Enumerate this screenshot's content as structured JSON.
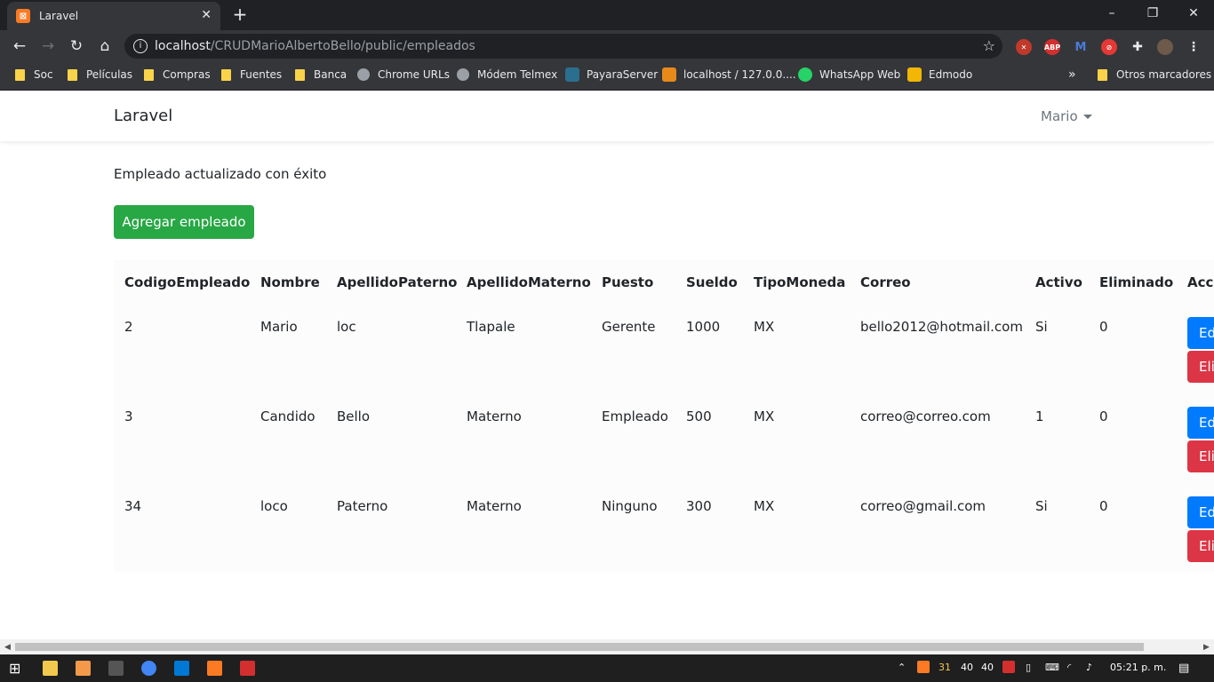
{
  "browser": {
    "tab_title": "Laravel",
    "tab_close": "✕",
    "new_tab": "+",
    "window_controls": {
      "minimize": "–",
      "restore": "❐",
      "close": "✕"
    },
    "url_host": "localhost",
    "url_path": "/CRUDMarioAlbertoBello/public/empleados",
    "extension_abp": "ABP",
    "bookmarks": [
      "Soc",
      "Películas",
      "Compras",
      "Fuentes",
      "Banca",
      "Chrome URLs",
      "Módem Telmex",
      "PayaraServer",
      "localhost / 127.0.0....",
      "WhatsApp Web",
      "Edmodo"
    ],
    "bookmarks_overflow": "»",
    "other_bookmarks": "Otros marcadores"
  },
  "app": {
    "brand": "Laravel",
    "user": "Mario",
    "flash_message": "Empleado actualizado con éxito",
    "add_button": "Agregar empleado"
  },
  "table": {
    "headers": [
      "CodigoEmpleado",
      "Nombre",
      "ApellidoPaterno",
      "ApellidoMaterno",
      "Puesto",
      "Sueldo",
      "TipoMoneda",
      "Correo",
      "Activo",
      "Eliminado",
      "Acci"
    ],
    "rows": [
      [
        "2",
        "Mario",
        "loc",
        "Tlapale",
        "Gerente",
        "1000",
        "MX",
        "bello2012@hotmail.com",
        "Si",
        "0"
      ],
      [
        "3",
        "Candido",
        "Bello",
        "Materno",
        "Empleado",
        "500",
        "MX",
        "correo@correo.com",
        "1",
        "0"
      ],
      [
        "34",
        "loco",
        "Paterno",
        "Materno",
        "Ninguno",
        "300",
        "MX",
        "correo@gmail.com",
        "Si",
        "0"
      ]
    ],
    "edit_label": "Ed",
    "delete_label": "Eli"
  },
  "taskbar": {
    "tray_counts": [
      "31",
      "40",
      "40"
    ],
    "clock": "05:21 p. m."
  }
}
